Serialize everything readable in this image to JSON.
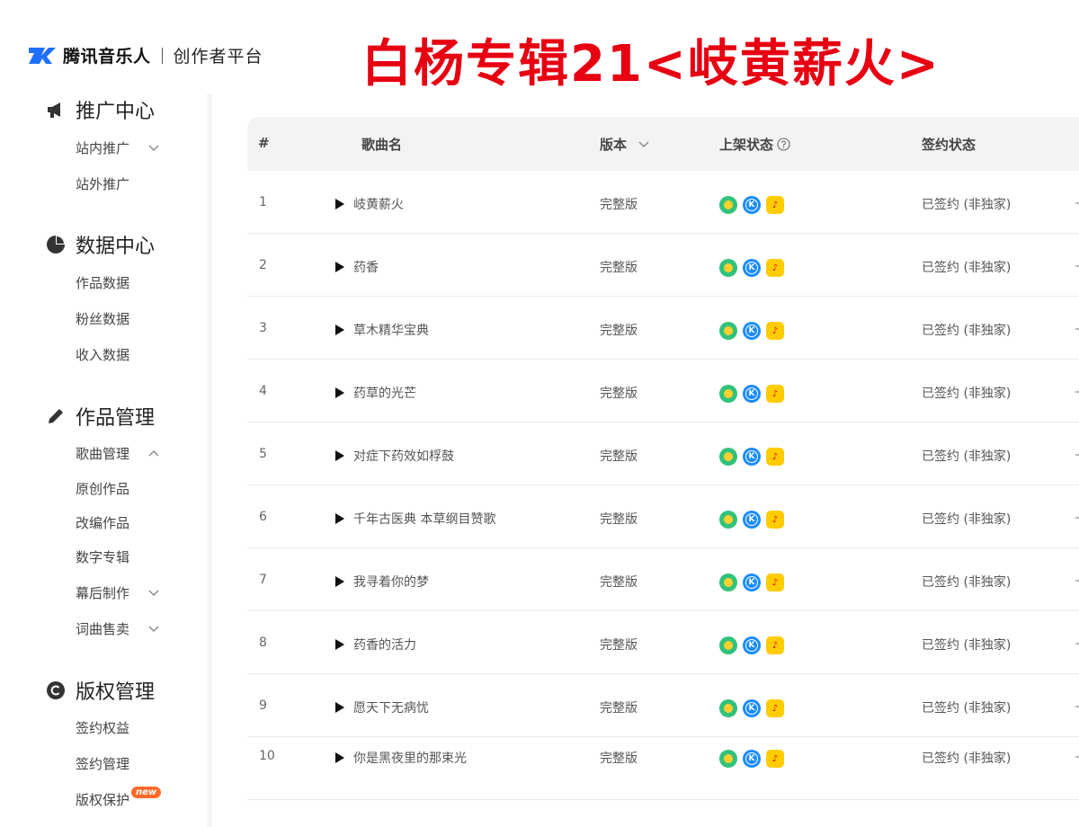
{
  "header": {
    "logo_text": "腾讯音乐人",
    "logo_sub": "创作者平台",
    "banner": "白杨专辑21<岐黄薪火>"
  },
  "sidebar": {
    "sections": [
      {
        "label": "推广中心",
        "icon": "megaphone-icon",
        "items": [
          {
            "label": "站内推广",
            "chevron": "down"
          },
          {
            "label": "站外推广"
          }
        ]
      },
      {
        "label": "数据中心",
        "icon": "pie-chart-icon",
        "items": [
          {
            "label": "作品数据"
          },
          {
            "label": "粉丝数据"
          },
          {
            "label": "收入数据"
          }
        ]
      },
      {
        "label": "作品管理",
        "icon": "pencil-icon",
        "items": [
          {
            "label": "歌曲管理",
            "chevron": "up"
          },
          {
            "label": "原创作品"
          },
          {
            "label": "改编作品"
          },
          {
            "label": "数字专辑"
          },
          {
            "label": "幕后制作",
            "chevron": "down"
          },
          {
            "label": "词曲售卖",
            "chevron": "down"
          }
        ]
      },
      {
        "label": "版权管理",
        "icon": "copyright-icon",
        "items": [
          {
            "label": "签约权益"
          },
          {
            "label": "签约管理"
          },
          {
            "label": "版权保护",
            "badge": "new"
          }
        ]
      }
    ]
  },
  "table": {
    "columns": {
      "num": "#",
      "name": "歌曲名",
      "version": "版本",
      "status": "上架状态",
      "sign": "签约状态"
    },
    "rows": [
      {
        "num": "1",
        "name": "岐黄薪火",
        "version": "完整版",
        "sign": "已签约 (非独家)"
      },
      {
        "num": "2",
        "name": "药香",
        "version": "完整版",
        "sign": "已签约 (非独家)"
      },
      {
        "num": "3",
        "name": "草木精华宝典",
        "version": "完整版",
        "sign": "已签约 (非独家)"
      },
      {
        "num": "4",
        "name": "药草的光芒",
        "version": "完整版",
        "sign": "已签约 (非独家)"
      },
      {
        "num": "5",
        "name": "对症下药效如桴鼓",
        "version": "完整版",
        "sign": "已签约 (非独家)"
      },
      {
        "num": "6",
        "name": "千年古医典 本草纲目赞歌",
        "version": "完整版",
        "sign": "已签约 (非独家)"
      },
      {
        "num": "7",
        "name": "我寻着你的梦",
        "version": "完整版",
        "sign": "已签约 (非独家)"
      },
      {
        "num": "8",
        "name": "药香的活力",
        "version": "完整版",
        "sign": "已签约 (非独家)"
      },
      {
        "num": "9",
        "name": "愿天下无病忧",
        "version": "完整版",
        "sign": "已签约 (非独家)"
      },
      {
        "num": "10",
        "name": "你是黑夜里的那束光",
        "version": "完整版",
        "sign": "已签约 (非独家)"
      }
    ],
    "platform_icons": [
      "qq-music-icon",
      "kugou-icon",
      "kuwo-icon"
    ]
  },
  "colors": {
    "banner": "#e60012",
    "header_bg": "#f2f3f5",
    "logo_blue": "#1f6fff"
  }
}
